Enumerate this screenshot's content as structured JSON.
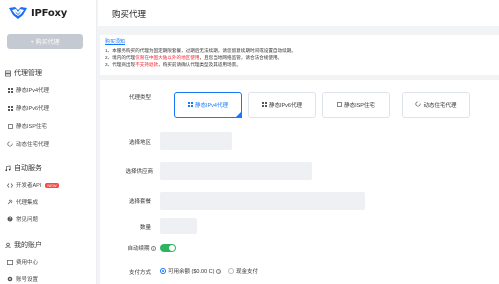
{
  "app": {
    "name": "IPFoxy"
  },
  "sidebar": {
    "buy_button": "+ 购买代理",
    "sections": [
      {
        "title": "代理管理",
        "items": [
          "静态IPv4代理",
          "静态IPv6代理",
          "静态ISP住宅",
          "动态住宅代理"
        ]
      },
      {
        "title": "自动服务",
        "items": [
          "开发者API",
          "代理集成",
          "常见问题"
        ]
      },
      {
        "title": "我的账户",
        "items": [
          "费用中心",
          "账号设置"
        ]
      }
    ],
    "new_badge": "NEW"
  },
  "header": {
    "title": "购买代理"
  },
  "notice": {
    "title": "购买须知",
    "line1": "1、本服务购买的代理为固定期限套餐，过期后无法续期，请您留意续期时间或设置自动续期。",
    "line2_a": "2、境内的代理",
    "line2_red": "仅限在中国大陆以外的地区使用",
    "line2_b": "，且您当地网络监管，请合法合规使用。",
    "line3_a": "3、代理商出现",
    "line3_red": "不支持退款",
    "line3_b": "，购买前请确认代理类型及其适用场景。"
  },
  "form": {
    "type_label": "代理类型",
    "types": [
      "静态IPv4代理",
      "静态IPv6代理",
      "静态ISP住宅",
      "动态住宅代理"
    ],
    "region_label": "选择地区",
    "provider_label": "选择供应商",
    "plan_label": "选择套餐",
    "qty_label": "数量",
    "autorenew_label": "自动续期",
    "autorenew_on": true,
    "pay_label": "支付方式",
    "pay_options": [
      "可用余额 ($0.00 C)",
      "现金支付"
    ],
    "pay_selected": 0
  },
  "colors": {
    "accent": "#1677ff",
    "toggle": "#2db55d",
    "danger": "#f5222d"
  }
}
